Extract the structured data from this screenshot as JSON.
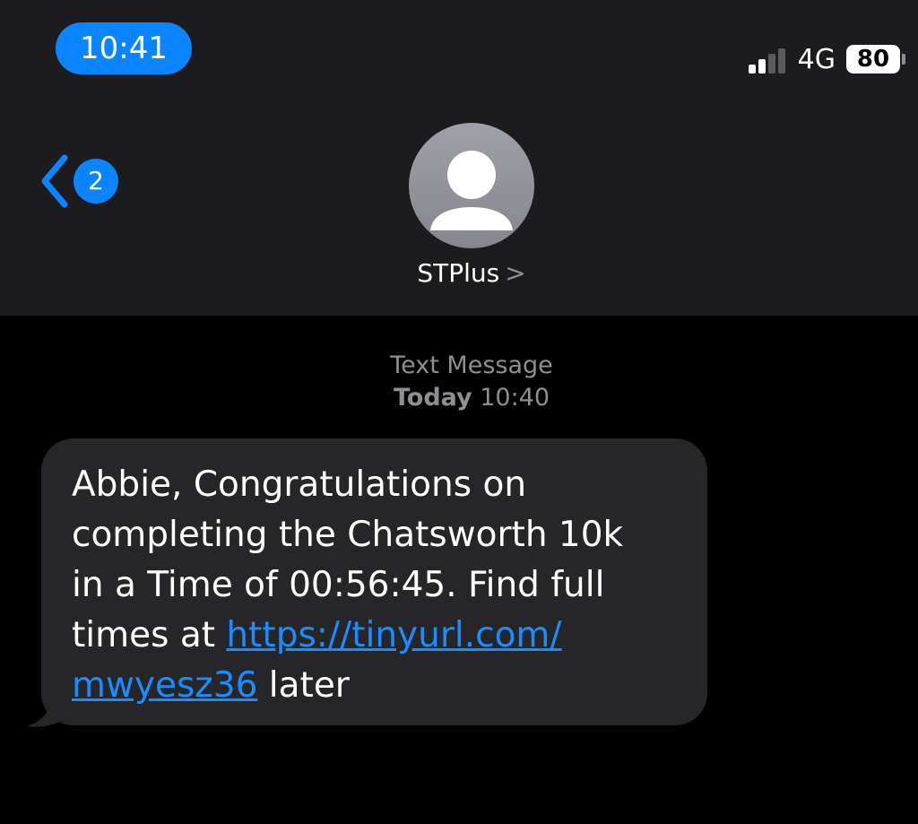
{
  "status_bar": {
    "time": "10:41",
    "network": "4G",
    "battery": "80",
    "signal_bars_active": 2,
    "signal_bars_total": 4
  },
  "nav": {
    "back_badge": "2",
    "contact_name": "STPlus",
    "contact_chevron": ">"
  },
  "conversation": {
    "service_label": "Text Message",
    "timestamp_day": "Today",
    "timestamp_time": "10:40"
  },
  "message": {
    "line1": "Abbie, Congratulations on",
    "line2": "completing the Chatsworth 10k",
    "line3": "in a Time of 00:56:45. Find full",
    "line4_prefix": "times at ",
    "link_part1": "https://tinyurl.com/",
    "link_part2": "mwyesz36",
    "line5_suffix": " later"
  },
  "colors": {
    "accent": "#0a84ff",
    "header_bg": "#1c1c1e",
    "bubble_bg": "#262629",
    "link": "#1a8cff",
    "muted_text": "#8e8e93"
  },
  "icons": {
    "back": "chevron-left-icon",
    "avatar": "person-icon",
    "contact_details": "chevron-right-icon"
  }
}
